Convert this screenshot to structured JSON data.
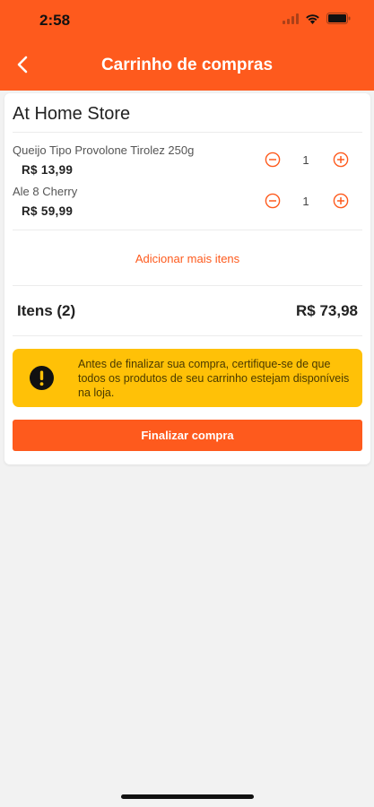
{
  "status_bar": {
    "time": "2:58"
  },
  "header": {
    "title": "Carrinho de compras",
    "back_icon": "chevron-left-icon"
  },
  "store": {
    "name": "At Home Store"
  },
  "items": [
    {
      "name": "Queijo Tipo Provolone Tirolez 250g",
      "price": "R$ 13,99",
      "quantity": "1"
    },
    {
      "name": "Ale 8 Cherry",
      "price": "R$ 59,99",
      "quantity": "1"
    }
  ],
  "add_more_label": "Adicionar mais itens",
  "summary": {
    "items_label": "Itens (2)",
    "total": "R$ 73,98"
  },
  "warning": {
    "icon": "exclamation-circle-icon",
    "text": "Antes de finalizar sua compra, certifique-se de que todos os produtos de seu carrinho estejam disponíveis na loja."
  },
  "checkout_label": "Finalizar compra",
  "colors": {
    "accent": "#fe5a1d",
    "warning": "#ffc107",
    "background": "#f2f2f2"
  }
}
